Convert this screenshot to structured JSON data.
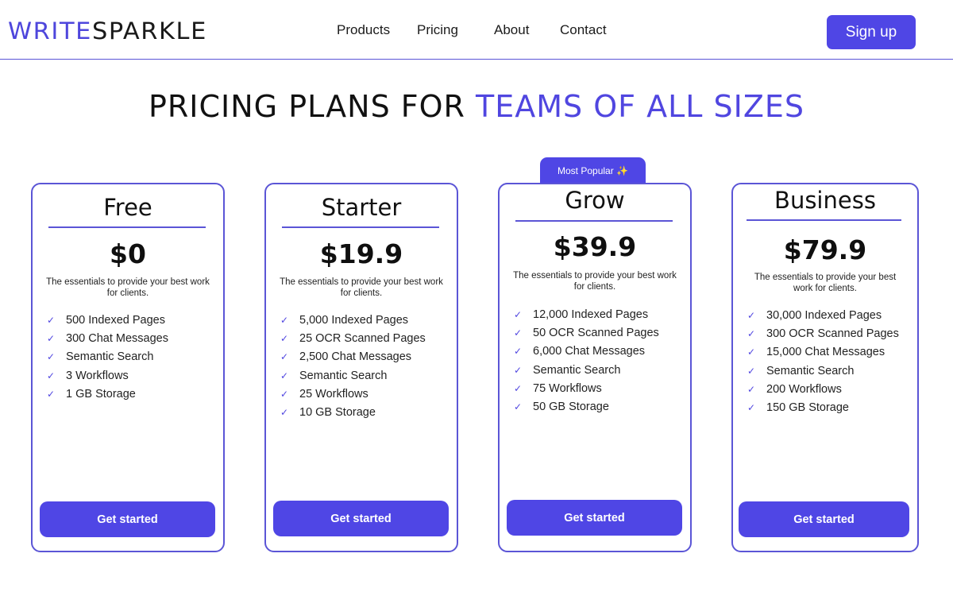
{
  "brand": {
    "logo_part1": "WRITE",
    "logo_part2": "SPARKLE"
  },
  "nav": {
    "items": [
      "Products",
      "Pricing",
      "About",
      "Contact"
    ],
    "signup_label": "Sign up"
  },
  "headline": {
    "part1": "PRICING PLANS FOR ",
    "part2": "TEAMS OF ALL SIZES"
  },
  "badge": {
    "label": "Most Popular ✨"
  },
  "plans": [
    {
      "name": "Free",
      "price": "$0",
      "description": "The essentials to provide your best work for clients.",
      "features": [
        "500 Indexed Pages",
        "300 Chat Messages",
        "Semantic Search",
        "3 Workflows",
        "1 GB Storage"
      ],
      "cta": "Get started"
    },
    {
      "name": "Starter",
      "price": "$19.9",
      "description": "The essentials to provide your best work for clients.",
      "features": [
        "5,000 Indexed Pages",
        "25 OCR Scanned Pages",
        "2,500 Chat Messages",
        "Semantic Search",
        "25 Workflows",
        "10 GB Storage"
      ],
      "cta": "Get started"
    },
    {
      "name": "Grow",
      "price": "$39.9",
      "description": "The essentials to provide your best work for clients.",
      "features": [
        "12,000 Indexed Pages",
        "50 OCR Scanned Pages",
        "6,000 Chat Messages",
        "Semantic Search",
        "75 Workflows",
        "50 GB Storage"
      ],
      "cta": "Get started"
    },
    {
      "name": "Business",
      "price": "$79.9",
      "description": "The essentials to provide your best work for clients.",
      "features": [
        "30,000 Indexed Pages",
        "300 OCR Scanned Pages",
        "15,000 Chat Messages",
        "Semantic Search",
        "200 Workflows",
        "150 GB Storage"
      ],
      "cta": "Get started"
    }
  ],
  "colors": {
    "accent": "#4f46e5",
    "border": "#5b55d6",
    "text": "#111111"
  },
  "icons": {
    "feature_check": "check-icon"
  }
}
